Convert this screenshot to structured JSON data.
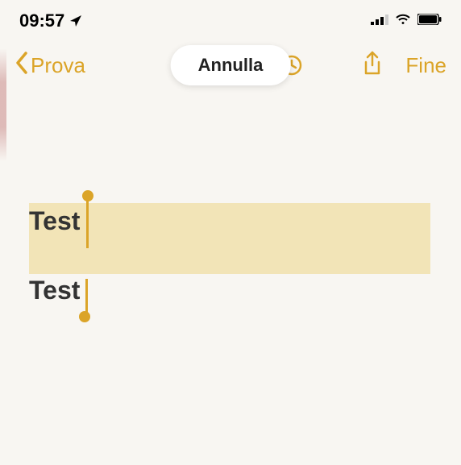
{
  "status_bar": {
    "time": "09:57"
  },
  "toolbar": {
    "back_label": "Prova",
    "cancel_label": "Annulla",
    "done_label": "Fine"
  },
  "note": {
    "line1": "Test",
    "line2": "Test"
  }
}
